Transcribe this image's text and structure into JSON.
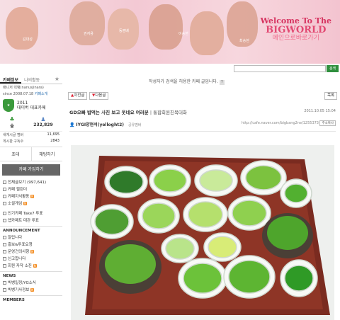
{
  "banner": {
    "title_line1": "Welcome To The",
    "title_line2": "BIGWORLD",
    "title_line3": "메인으로바로가기",
    "members": [
      "감대성",
      "권지용",
      "동영배",
      "이승현",
      "최승현"
    ]
  },
  "search": {
    "button": "검색"
  },
  "sidebar": {
    "tabs": [
      "카페정보",
      "나의활동"
    ],
    "manager_label": "매니저",
    "manager": "빅뱅(nanusjinara)",
    "since": "since 2008.07.18",
    "cafe_intro": "카페소개",
    "badge_year": "2011",
    "badge_text": "대이버 대표카페",
    "stats": [
      {
        "icon": "grade-icon",
        "label": "숲"
      },
      {
        "icon": "members-icon",
        "label": "232,829"
      }
    ],
    "info": [
      {
        "k": "새게시글 캠버",
        "v": "11,695"
      },
      {
        "k": "게시판 구독수",
        "v": "2843"
      }
    ],
    "buttons": [
      "초대",
      "채팅하기"
    ],
    "join": "카페 가입하기",
    "menu1": [
      {
        "label": "전체글보기",
        "count": "(997,641)"
      },
      {
        "label": "카페 캘린더"
      },
      {
        "label": "카페지식활동",
        "new": "N"
      },
      {
        "label": "소셜게임",
        "new": "N"
      }
    ],
    "menu2": [
      {
        "label": "인기카페 Take7 투표"
      },
      {
        "label": "앱카페트 대관 투표"
      }
    ],
    "sections": [
      "ANNOUNCEMENT",
      "NEWS",
      "MEMBERS"
    ],
    "announcement": [
      {
        "label": "알립니다"
      },
      {
        "label": "홍보&투표요청"
      },
      {
        "label": "운영건의사항",
        "new": "N"
      },
      {
        "label": "신고합니다"
      },
      {
        "label": "회원 자작 소진",
        "new": "N"
      }
    ],
    "news": [
      {
        "label": "빅뱅일정/YG소식"
      },
      {
        "label": "빅뱅기사정보",
        "new": "N"
      }
    ]
  },
  "main": {
    "notice": "작성자가 검색을 허용한 카페 글입니다.",
    "prev": "이전글",
    "next": "다음글",
    "list": "목록",
    "post_title": "GD오빠 밥먹는 사진 보고 웃네요 여러분",
    "post_category": "| 통합회원친목대화",
    "post_date": "2011.10.05 15:04",
    "author": "IYGI양현석(yelloght2)",
    "author_grade": "공유멤버",
    "permalink": "http://cafe.naver.com/bigbang2ne/1255373",
    "copy": "주소복사"
  },
  "colors": {
    "accent_green": "#2f8f3d",
    "badge_green": "#3b9a3c",
    "banner_pink": "#f3c9d4"
  }
}
